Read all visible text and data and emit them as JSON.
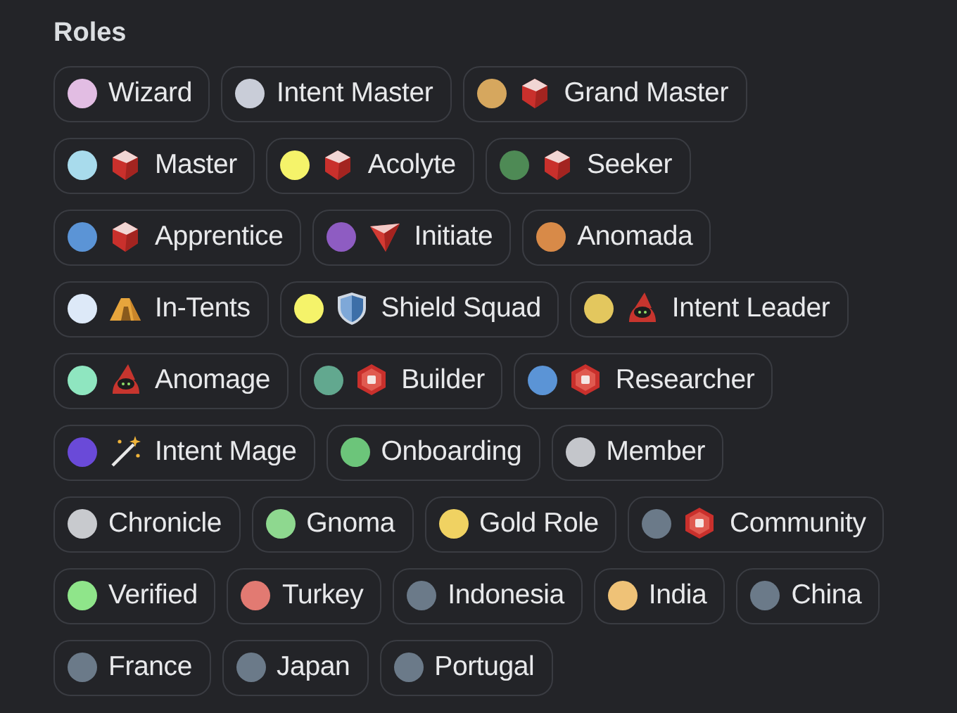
{
  "title": "Roles",
  "roles": [
    {
      "name": "Wizard",
      "color": "#e2bde3",
      "kind": "plain"
    },
    {
      "name": "Intent Master",
      "color": "#c9cdd8",
      "kind": "plain"
    },
    {
      "name": "Grand Master",
      "color": "#d6a75e",
      "kind": "gem"
    },
    {
      "name": "Master",
      "color": "#a8dbec",
      "kind": "gem"
    },
    {
      "name": "Acolyte",
      "color": "#f5f36a",
      "kind": "gem"
    },
    {
      "name": "Seeker",
      "color": "#4e8a55",
      "kind": "gem"
    },
    {
      "name": "Apprentice",
      "color": "#5b94d6",
      "kind": "gem"
    },
    {
      "name": "Initiate",
      "color": "#8e5cc2",
      "kind": "triangle"
    },
    {
      "name": "Anomada",
      "color": "#d88a48",
      "kind": "plain"
    },
    {
      "name": "In-Tents",
      "color": "#dde9f8",
      "kind": "tent"
    },
    {
      "name": "Shield Squad",
      "color": "#f5f36a",
      "kind": "shield"
    },
    {
      "name": "Intent Leader",
      "color": "#e3c75e",
      "kind": "wizard"
    },
    {
      "name": "Anomage",
      "color": "#8fe6c0",
      "kind": "wizard"
    },
    {
      "name": "Builder",
      "color": "#62a88f",
      "kind": "hexbadge"
    },
    {
      "name": "Researcher",
      "color": "#5b94d6",
      "kind": "hexbadge"
    },
    {
      "name": "Intent Mage",
      "color": "#6a4ad8",
      "kind": "wand"
    },
    {
      "name": "Onboarding",
      "color": "#6cc57a",
      "kind": "plain"
    },
    {
      "name": "Member",
      "color": "#c4c6cb",
      "kind": "plain"
    },
    {
      "name": "Chronicle",
      "color": "#c8cace",
      "kind": "plain"
    },
    {
      "name": "Gnoma",
      "color": "#8ed88f",
      "kind": "plain"
    },
    {
      "name": "Gold Role",
      "color": "#f0d262",
      "kind": "plain"
    },
    {
      "name": "Community",
      "color": "#6b7a89",
      "kind": "hexbadge"
    },
    {
      "name": "Verified",
      "color": "#8fe58a",
      "kind": "plain"
    },
    {
      "name": "Turkey",
      "color": "#e27a72",
      "kind": "plain"
    },
    {
      "name": "Indonesia",
      "color": "#6b7a89",
      "kind": "plain"
    },
    {
      "name": "India",
      "color": "#efc277",
      "kind": "plain"
    },
    {
      "name": "China",
      "color": "#6b7a89",
      "kind": "plain"
    },
    {
      "name": "France",
      "color": "#6b7a89",
      "kind": "plain"
    },
    {
      "name": "Japan",
      "color": "#6b7a89",
      "kind": "plain"
    },
    {
      "name": "Portugal",
      "color": "#6b7a89",
      "kind": "plain"
    }
  ]
}
